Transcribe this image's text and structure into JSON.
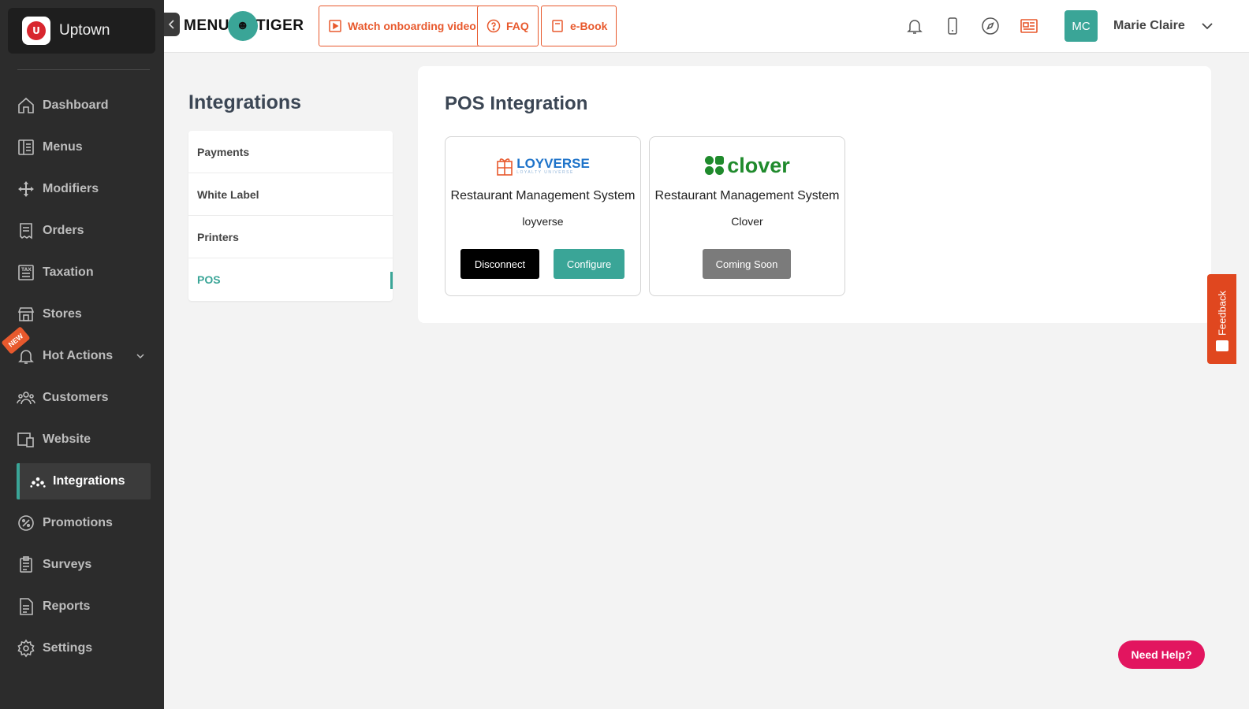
{
  "brand": {
    "name": "Uptown",
    "logo_initial": "U"
  },
  "sidebar": {
    "items": [
      {
        "label": "Dashboard",
        "icon": "home-icon"
      },
      {
        "label": "Menus",
        "icon": "menu-book-icon"
      },
      {
        "label": "Modifiers",
        "icon": "move-arrows-icon"
      },
      {
        "label": "Orders",
        "icon": "receipt-icon"
      },
      {
        "label": "Taxation",
        "icon": "tax-icon"
      },
      {
        "label": "Stores",
        "icon": "store-icon"
      },
      {
        "label": "Hot Actions",
        "icon": "bell-icon",
        "badge": "NEW"
      },
      {
        "label": "Customers",
        "icon": "users-icon"
      },
      {
        "label": "Website",
        "icon": "devices-icon"
      },
      {
        "label": "Integrations",
        "icon": "integrations-icon",
        "active": true
      },
      {
        "label": "Promotions",
        "icon": "promotion-icon"
      },
      {
        "label": "Surveys",
        "icon": "clipboard-icon"
      },
      {
        "label": "Reports",
        "icon": "report-icon"
      },
      {
        "label": "Settings",
        "icon": "gear-icon"
      }
    ]
  },
  "topbar": {
    "logo_left": "MENU",
    "logo_right": "TIGER",
    "watch_label": "Watch onboarding video",
    "faq_label": "FAQ",
    "ebook_label": "e-Book",
    "user_initials": "MC",
    "user_name": "Marie Claire"
  },
  "page": {
    "title": "Integrations",
    "subnav": [
      "Payments",
      "White Label",
      "Printers",
      "POS"
    ],
    "active_subnav": "POS"
  },
  "main": {
    "title": "POS Integration",
    "cards": [
      {
        "logo_text": "LOYVERSE",
        "logo_tagline": "LOYALTY UNIVERSE",
        "name": "Restaurant Management System",
        "provider": "loyverse",
        "primary_button": "Disconnect",
        "secondary_button": "Configure"
      },
      {
        "logo_text": "clover",
        "name": "Restaurant Management System",
        "provider": "Clover",
        "button": "Coming Soon"
      }
    ]
  },
  "feedback_label": "Feedback",
  "help_label": "Need Help?",
  "colors": {
    "accent": "#3aa597",
    "orange": "#e8592d",
    "help": "#e2155f",
    "sidebar": "#2c2c2c"
  }
}
